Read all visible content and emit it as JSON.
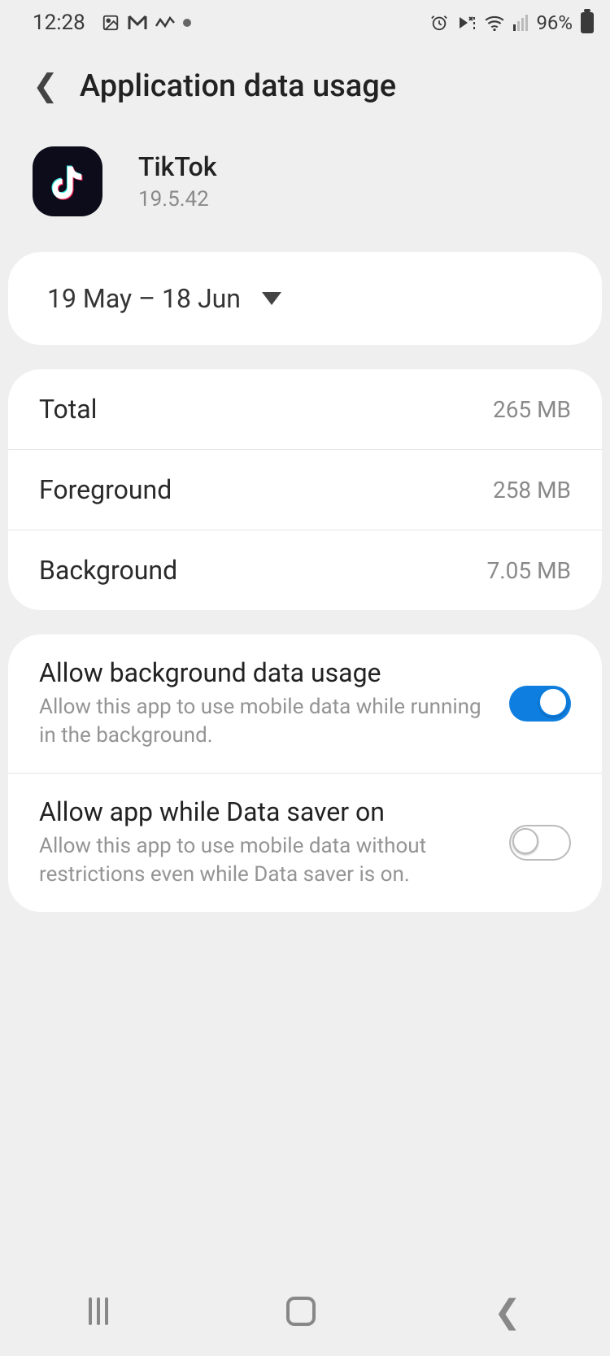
{
  "statusbar": {
    "time": "12:28",
    "battery_percent": "96%"
  },
  "header": {
    "title": "Application data usage"
  },
  "app": {
    "name": "TikTok",
    "version": "19.5.42"
  },
  "date_range": "19 May – 18 Jun",
  "usage": [
    {
      "label": "Total",
      "value": "265 MB"
    },
    {
      "label": "Foreground",
      "value": "258 MB"
    },
    {
      "label": "Background",
      "value": "7.05 MB"
    }
  ],
  "settings": [
    {
      "title": "Allow background data usage",
      "desc": "Allow this app to use mobile data while running in the background.",
      "on": true
    },
    {
      "title": "Allow app while Data saver on",
      "desc": "Allow this app to use mobile data without restrictions even while Data saver is on.",
      "on": false
    }
  ]
}
